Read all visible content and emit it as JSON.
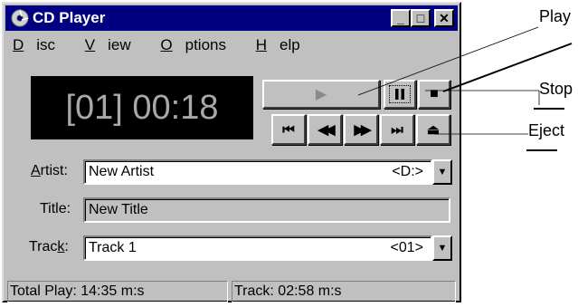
{
  "window": {
    "title": "CD Player",
    "controls": {
      "minimize": "_",
      "maximize": "□",
      "close": "✕"
    }
  },
  "menu": {
    "disc": {
      "first": "D",
      "rest": "isc"
    },
    "view": {
      "first": "V",
      "rest": "iew"
    },
    "options": {
      "first": "O",
      "rest": "ptions"
    },
    "help": {
      "first": "H",
      "rest": "elp"
    }
  },
  "display": {
    "readout": "[01] 00:18"
  },
  "buttons": {
    "play": "▶",
    "stop": "■",
    "prev_track": "⏮",
    "rewind": "◀◀",
    "fast_forward": "▶▶",
    "next_track": "⏭",
    "eject": "⏏"
  },
  "artist": {
    "label_u": "A",
    "label_rest": "rtist:",
    "value": "New Artist",
    "drive": "<D:>"
  },
  "title": {
    "label": "Title:",
    "value": "New Title"
  },
  "track": {
    "label_pre": "Trac",
    "label_u": "k",
    "label_post": ":",
    "value": "Track 1",
    "number": "<01>"
  },
  "status": {
    "total_play": "Total Play: 14:35 m:s",
    "track_time": "Track: 02:58 m:s"
  },
  "callouts": {
    "play": "Play",
    "stop": "Stop",
    "eject": "Eject"
  },
  "colors": {
    "titlebar": "#000080",
    "face": "#c0c0c0",
    "lcd_bg": "#000000",
    "lcd_text": "#a8a8a8"
  }
}
